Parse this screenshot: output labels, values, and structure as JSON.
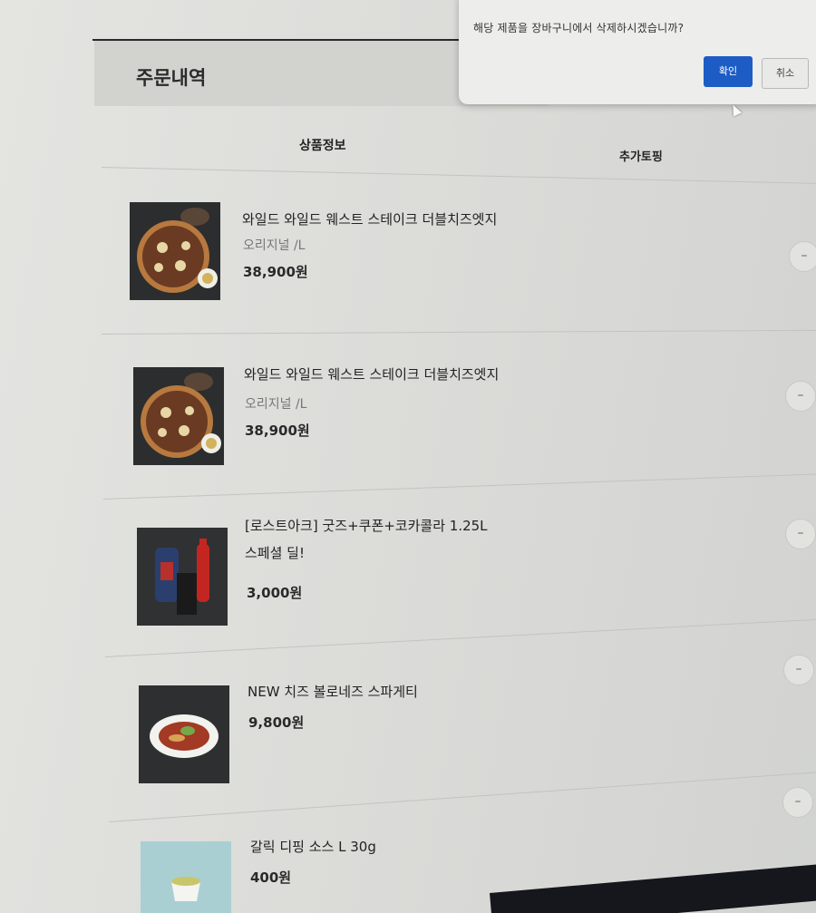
{
  "order": {
    "title": "주문내역"
  },
  "columns": {
    "product": "상품정보",
    "topping": "추가토핑"
  },
  "items": [
    {
      "name": "와일드 와일드 웨스트 스테이크 더블치즈엣지",
      "option": "오리지널 /L",
      "price": "38,900원",
      "image": "pizza-image"
    },
    {
      "name": "와일드 와일드 웨스트 스테이크 더블치즈엣지",
      "option": "오리지널 /L",
      "price": "38,900원",
      "image": "pizza-image"
    },
    {
      "name": "[로스트아크] 굿즈+쿠폰+코카콜라 1.25L 스페셜 딜!",
      "option": "",
      "price": "3,000원",
      "image": "goods-cola-image"
    },
    {
      "name": "NEW 치즈 볼로네즈 스파게티",
      "option": "",
      "price": "9,800원",
      "image": "spaghetti-image"
    },
    {
      "name": "갈릭 디핑 소스 L 30g",
      "option": "",
      "price": "400원",
      "image": "garlic-sauce-image"
    }
  ],
  "minus_label": "–",
  "dialog": {
    "message": "해당 제품을 장바구니에서 삭제하시겠습니까?",
    "confirm_label": "확인",
    "cancel_label": "취소"
  },
  "colors": {
    "confirm": "#1d5cc4",
    "background": "#dcdcd9"
  }
}
